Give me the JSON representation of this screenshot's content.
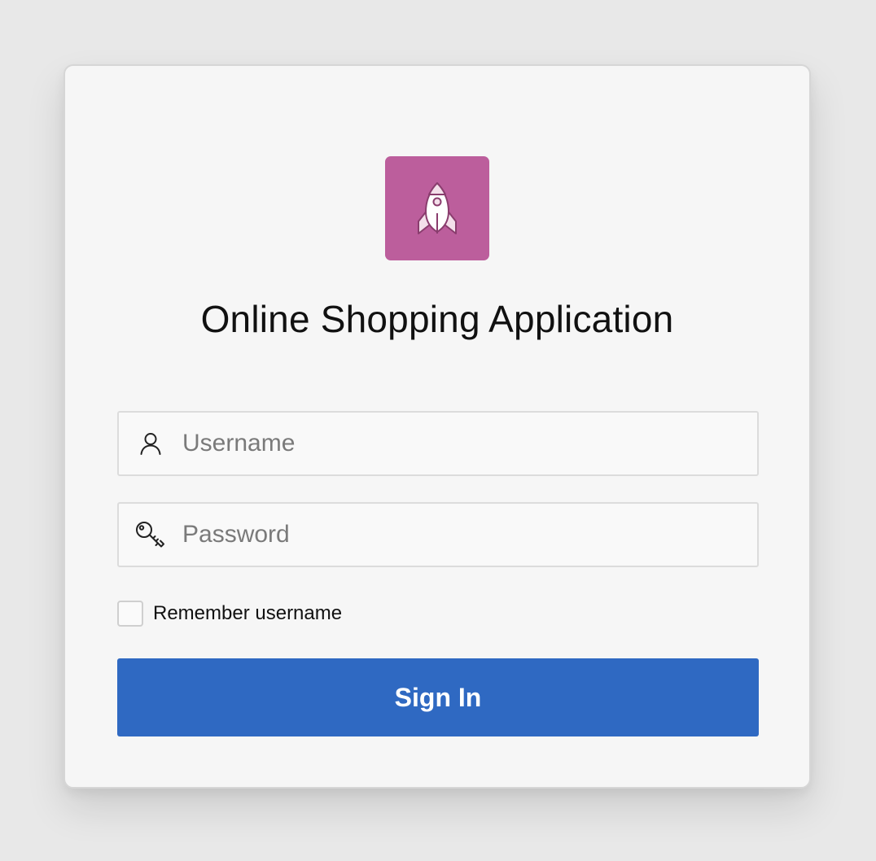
{
  "app": {
    "title": "Online Shopping Application",
    "logo_icon": "rocket-icon",
    "logo_color": "#bc5e9c"
  },
  "form": {
    "username": {
      "icon": "user-icon",
      "placeholder": "Username",
      "value": ""
    },
    "password": {
      "icon": "key-icon",
      "placeholder": "Password",
      "value": ""
    },
    "remember": {
      "label": "Remember username",
      "checked": false
    },
    "submit": {
      "label": "Sign In",
      "color": "#2f69c2"
    }
  }
}
